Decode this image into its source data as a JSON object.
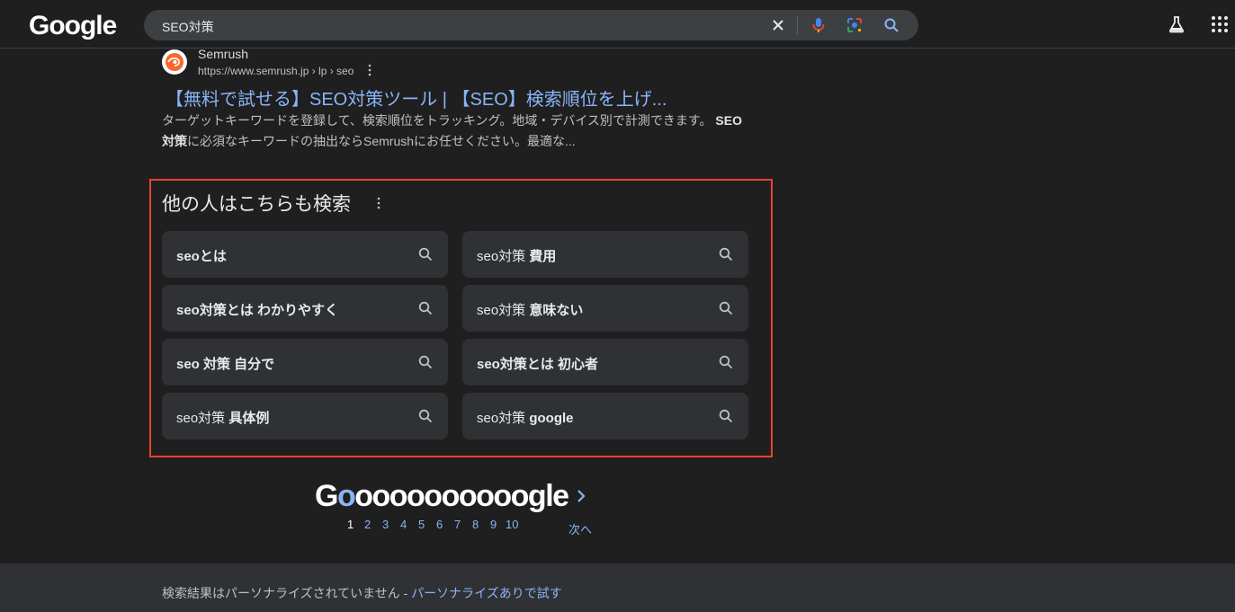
{
  "header": {
    "logo": "Google",
    "search_value": "SEO対策"
  },
  "result": {
    "site_name": "Semrush",
    "url": "https://www.semrush.jp › lp › seo",
    "title": "【無料で試せる】SEO対策ツール | 【SEO】検索順位を上げ...",
    "snippet_part1": "ターゲットキーワードを登録して、検索順位をトラッキング。地域・デバイス別で計測できます。",
    "snippet_bold1": "SEO",
    "snippet_bold2": "対策",
    "snippet_part2": "に必須なキーワードの抽出ならSemrushにお任せください。最適な..."
  },
  "people_also_search": {
    "title": "他の人はこちらも検索",
    "items": [
      {
        "pre": "",
        "bold": "seoとは"
      },
      {
        "pre": "seo対策 ",
        "bold": "費用"
      },
      {
        "pre": "",
        "bold": "seo対策とは わかりやすく"
      },
      {
        "pre": "seo対策 ",
        "bold": "意味ない"
      },
      {
        "pre": "",
        "bold": "seo 対策 自分で"
      },
      {
        "pre": "",
        "bold": "seo対策とは 初心者"
      },
      {
        "pre": "seo対策 ",
        "bold": "具体例"
      },
      {
        "pre": "seo対策 ",
        "bold": "google"
      }
    ]
  },
  "pagination": {
    "logo_g": "G",
    "logo_blue_o": "o",
    "logo_rest": "oooooooooogle",
    "pages": [
      "1",
      "2",
      "3",
      "4",
      "5",
      "6",
      "7",
      "8",
      "9",
      "10"
    ],
    "current_page": "1",
    "next_label": "次へ"
  },
  "footer": {
    "text": "検索結果はパーソナライズされていません - ",
    "link": "パーソナライズありで試す"
  },
  "colors": {
    "background": "#1f1f1f",
    "link": "#8ab4f8",
    "highlight_frame": "#e8432f",
    "chip": "#303134"
  }
}
